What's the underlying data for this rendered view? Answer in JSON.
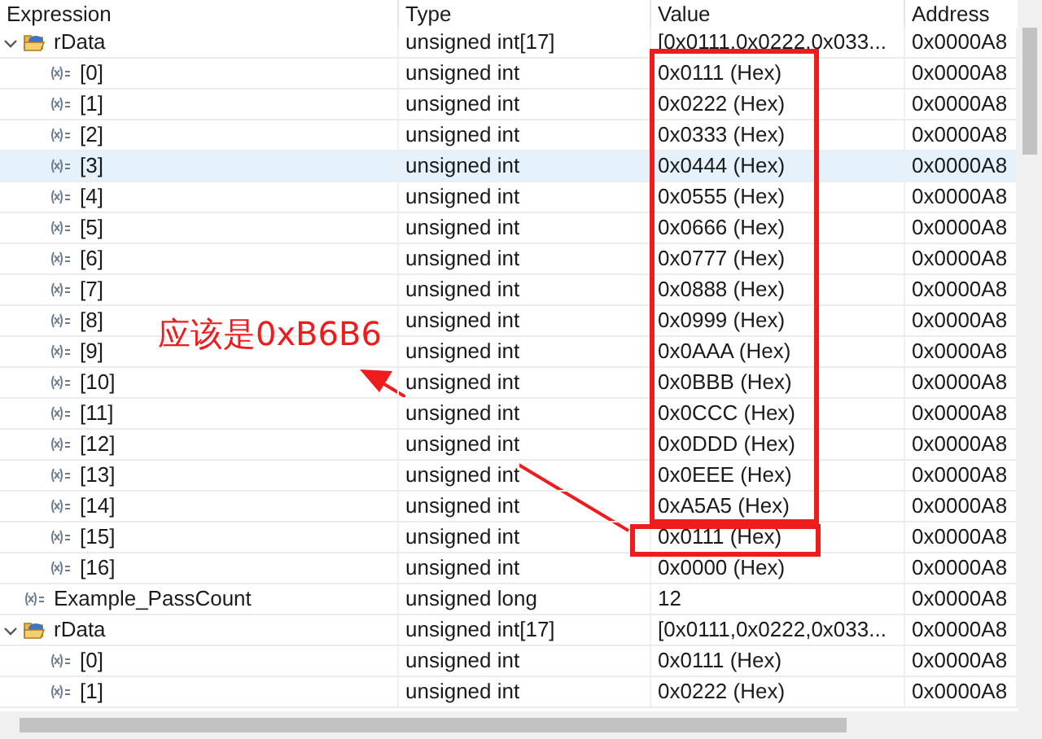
{
  "columns": [
    "Expression",
    "Type",
    "Value",
    "Address"
  ],
  "rows": [
    {
      "kind": "array",
      "expression": "rData",
      "type": "unsigned int[17]",
      "value": "[0x0111,0x0222,0x033...",
      "address": "0x0000A8",
      "expanded": true,
      "selected": false,
      "children": [
        {
          "kind": "variable",
          "expression": "[0]",
          "type": "unsigned int",
          "value": "0x0111 (Hex)",
          "address": "0x0000A8",
          "selected": false
        },
        {
          "kind": "variable",
          "expression": "[1]",
          "type": "unsigned int",
          "value": "0x0222 (Hex)",
          "address": "0x0000A8",
          "selected": false
        },
        {
          "kind": "variable",
          "expression": "[2]",
          "type": "unsigned int",
          "value": "0x0333 (Hex)",
          "address": "0x0000A8",
          "selected": false
        },
        {
          "kind": "variable",
          "expression": "[3]",
          "type": "unsigned int",
          "value": "0x0444 (Hex)",
          "address": "0x0000A8",
          "selected": true
        },
        {
          "kind": "variable",
          "expression": "[4]",
          "type": "unsigned int",
          "value": "0x0555 (Hex)",
          "address": "0x0000A8",
          "selected": false
        },
        {
          "kind": "variable",
          "expression": "[5]",
          "type": "unsigned int",
          "value": "0x0666 (Hex)",
          "address": "0x0000A8",
          "selected": false
        },
        {
          "kind": "variable",
          "expression": "[6]",
          "type": "unsigned int",
          "value": "0x0777 (Hex)",
          "address": "0x0000A8",
          "selected": false
        },
        {
          "kind": "variable",
          "expression": "[7]",
          "type": "unsigned int",
          "value": "0x0888 (Hex)",
          "address": "0x0000A8",
          "selected": false
        },
        {
          "kind": "variable",
          "expression": "[8]",
          "type": "unsigned int",
          "value": "0x0999 (Hex)",
          "address": "0x0000A8",
          "selected": false
        },
        {
          "kind": "variable",
          "expression": "[9]",
          "type": "unsigned int",
          "value": "0x0AAA (Hex)",
          "address": "0x0000A8",
          "selected": false
        },
        {
          "kind": "variable",
          "expression": "[10]",
          "type": "unsigned int",
          "value": "0x0BBB (Hex)",
          "address": "0x0000A8",
          "selected": false
        },
        {
          "kind": "variable",
          "expression": "[11]",
          "type": "unsigned int",
          "value": "0x0CCC (Hex)",
          "address": "0x0000A8",
          "selected": false
        },
        {
          "kind": "variable",
          "expression": "[12]",
          "type": "unsigned int",
          "value": "0x0DDD (Hex)",
          "address": "0x0000A8",
          "selected": false
        },
        {
          "kind": "variable",
          "expression": "[13]",
          "type": "unsigned int",
          "value": "0x0EEE (Hex)",
          "address": "0x0000A8",
          "selected": false
        },
        {
          "kind": "variable",
          "expression": "[14]",
          "type": "unsigned int",
          "value": "0xA5A5 (Hex)",
          "address": "0x0000A8",
          "selected": false
        },
        {
          "kind": "variable",
          "expression": "[15]",
          "type": "unsigned int",
          "value": "0x0111 (Hex)",
          "address": "0x0000A8",
          "selected": false
        },
        {
          "kind": "variable",
          "expression": "[16]",
          "type": "unsigned int",
          "value": "0x0000 (Hex)",
          "address": "0x0000A8",
          "selected": false
        }
      ]
    },
    {
      "kind": "variable",
      "expression": "Example_PassCount",
      "type": "unsigned long",
      "value": "12",
      "address": "0x0000A8",
      "selected": false
    },
    {
      "kind": "array",
      "expression": "rData",
      "type": "unsigned int[17]",
      "value": "[0x0111,0x0222,0x033...",
      "address": "0x0000A8",
      "expanded": true,
      "selected": false,
      "children": [
        {
          "kind": "variable",
          "expression": "[0]",
          "type": "unsigned int",
          "value": "0x0111 (Hex)",
          "address": "0x0000A8",
          "selected": false
        },
        {
          "kind": "variable",
          "expression": "[1]",
          "type": "unsigned int",
          "value": "0x0222 (Hex)",
          "address": "0x0000A8",
          "selected": false
        }
      ]
    }
  ],
  "annotation": {
    "text": "应该是0xB6B6"
  }
}
